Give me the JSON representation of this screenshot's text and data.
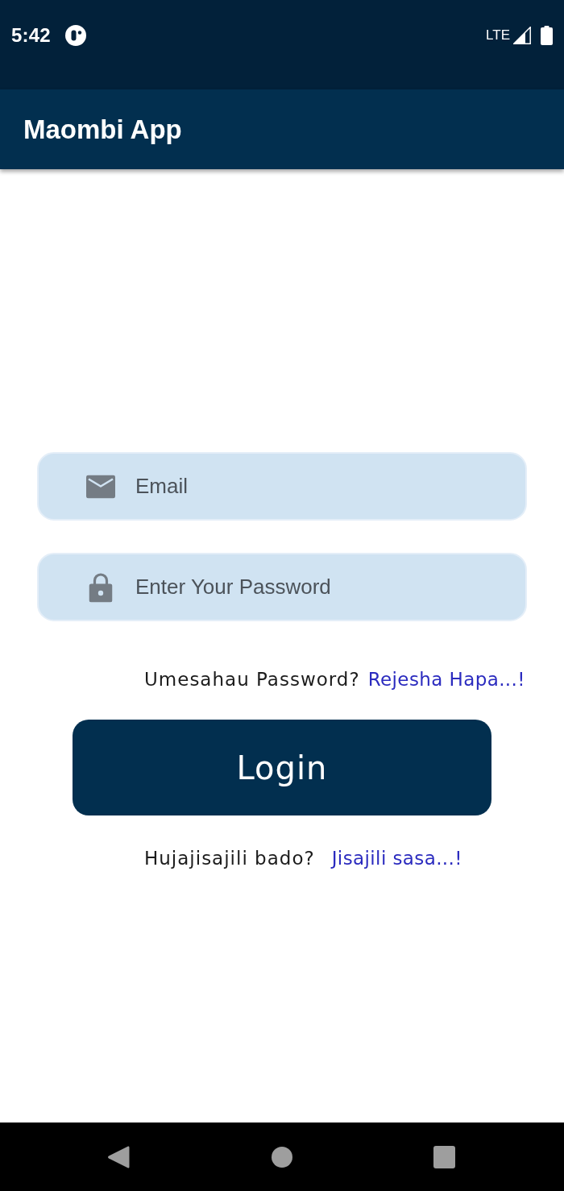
{
  "status_bar": {
    "time": "5:42",
    "network": "LTE"
  },
  "app_bar": {
    "title": "Maombi App"
  },
  "login_form": {
    "fields": [
      {
        "kind": "email",
        "placeholder": "Email"
      },
      {
        "kind": "password",
        "placeholder": "Enter Your Password"
      }
    ],
    "forgot_password": {
      "prompt": "Umesahau Password?",
      "link": "Rejesha Hapa...!"
    },
    "login_button": {
      "label": "Login"
    },
    "register": {
      "prompt": "Hujajisajili bado?",
      "link": "Jisajili sasa...!"
    }
  }
}
